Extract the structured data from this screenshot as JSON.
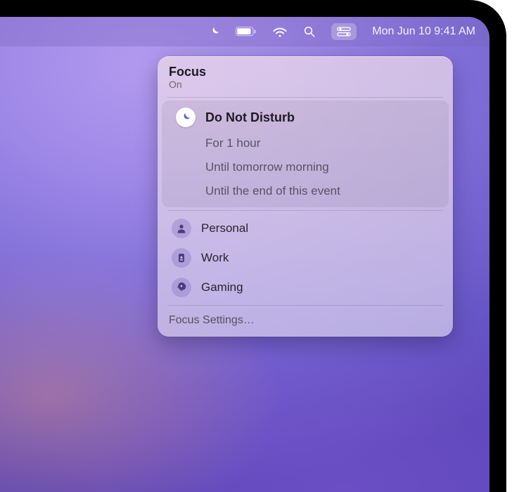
{
  "menubar": {
    "items": {
      "focus": "focus-icon",
      "battery": "battery-icon",
      "wifi": "wifi-icon",
      "spotlight": "search-icon",
      "control_center": "control-center-icon"
    },
    "clock": "Mon Jun 10  9:41 AM"
  },
  "focus_panel": {
    "title": "Focus",
    "status": "On",
    "dnd": {
      "label": "Do Not Disturb",
      "selected": true,
      "durations": [
        "For 1 hour",
        "Until tomorrow morning",
        "Until the end of this event"
      ]
    },
    "modes": [
      {
        "icon": "person-icon",
        "label": "Personal"
      },
      {
        "icon": "badge-icon",
        "label": "Work"
      },
      {
        "icon": "rocket-icon",
        "label": "Gaming"
      }
    ],
    "settings_label": "Focus Settings…"
  }
}
